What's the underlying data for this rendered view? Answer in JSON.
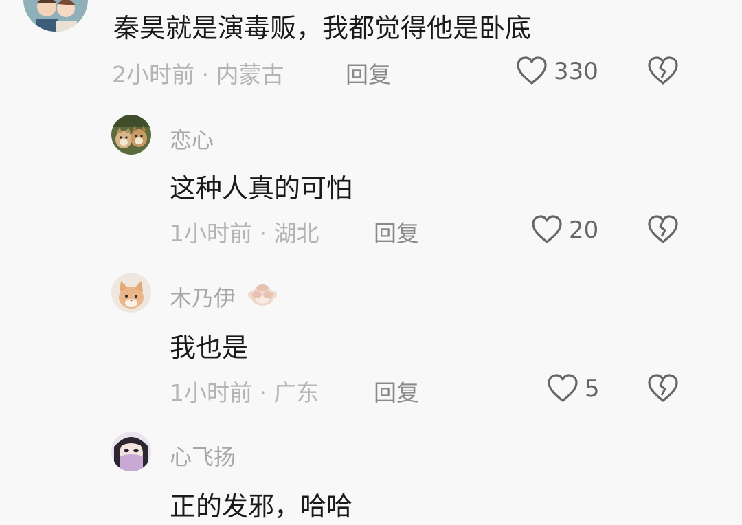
{
  "comments": [
    {
      "content": "秦昊就是演毒贩，我都觉得他是卧底",
      "meta": "2小时前 · 内蒙古",
      "reply_label": "回复",
      "likes": "330"
    },
    {
      "username": "恋心",
      "content": "这种人真的可怕",
      "meta": "1小时前 · 湖北",
      "reply_label": "回复",
      "likes": "20"
    },
    {
      "username": "木乃伊",
      "username_emoji": "monkey-emoji",
      "content": "我也是",
      "meta": "1小时前 · 广东",
      "reply_label": "回复",
      "likes": "5"
    },
    {
      "username": "心飞扬",
      "content": "正的发邪，哈哈"
    }
  ],
  "icons": {
    "like": "heart-outline-icon",
    "dislike": "broken-heart-icon"
  },
  "colors": {
    "background": "#f8f8f8",
    "content_text": "#1a1a1a",
    "meta_text": "#b4b4b4",
    "username_text": "#a6a6a6",
    "icon_stroke": "#666666"
  }
}
